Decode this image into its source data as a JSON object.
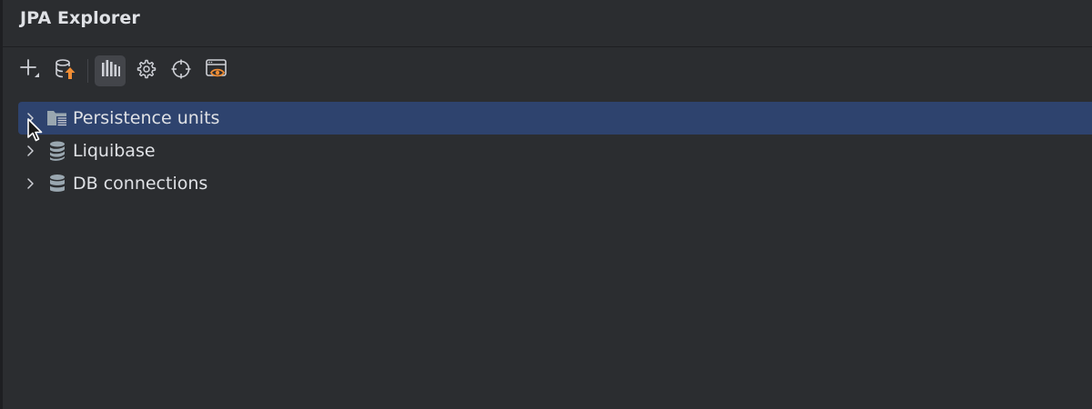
{
  "panel": {
    "title": "JPA Explorer"
  },
  "toolbar": {
    "buttons": [
      {
        "icon": "plus-with-dropdown-icon"
      },
      {
        "icon": "database-update-icon",
        "accent": "#f08d35"
      },
      {
        "icon": "bar-chart-icon",
        "active": true
      },
      {
        "icon": "gear-icon"
      },
      {
        "icon": "crosshair-icon"
      },
      {
        "icon": "eye-preview-icon",
        "accent": "#f08d35"
      }
    ]
  },
  "tree": {
    "items": [
      {
        "label": "Persistence units",
        "icon": "persistence-folder-icon",
        "selected": true,
        "expanded": false
      },
      {
        "label": "Liquibase",
        "icon": "liquibase-icon",
        "selected": false,
        "expanded": false
      },
      {
        "label": "DB connections",
        "icon": "database-icon",
        "selected": false,
        "expanded": false
      }
    ]
  },
  "colors": {
    "background": "#2b2d30",
    "selection": "#2e436e",
    "text": "#dfe1e5",
    "icon": "#ced0d6",
    "accent": "#f08d35"
  }
}
